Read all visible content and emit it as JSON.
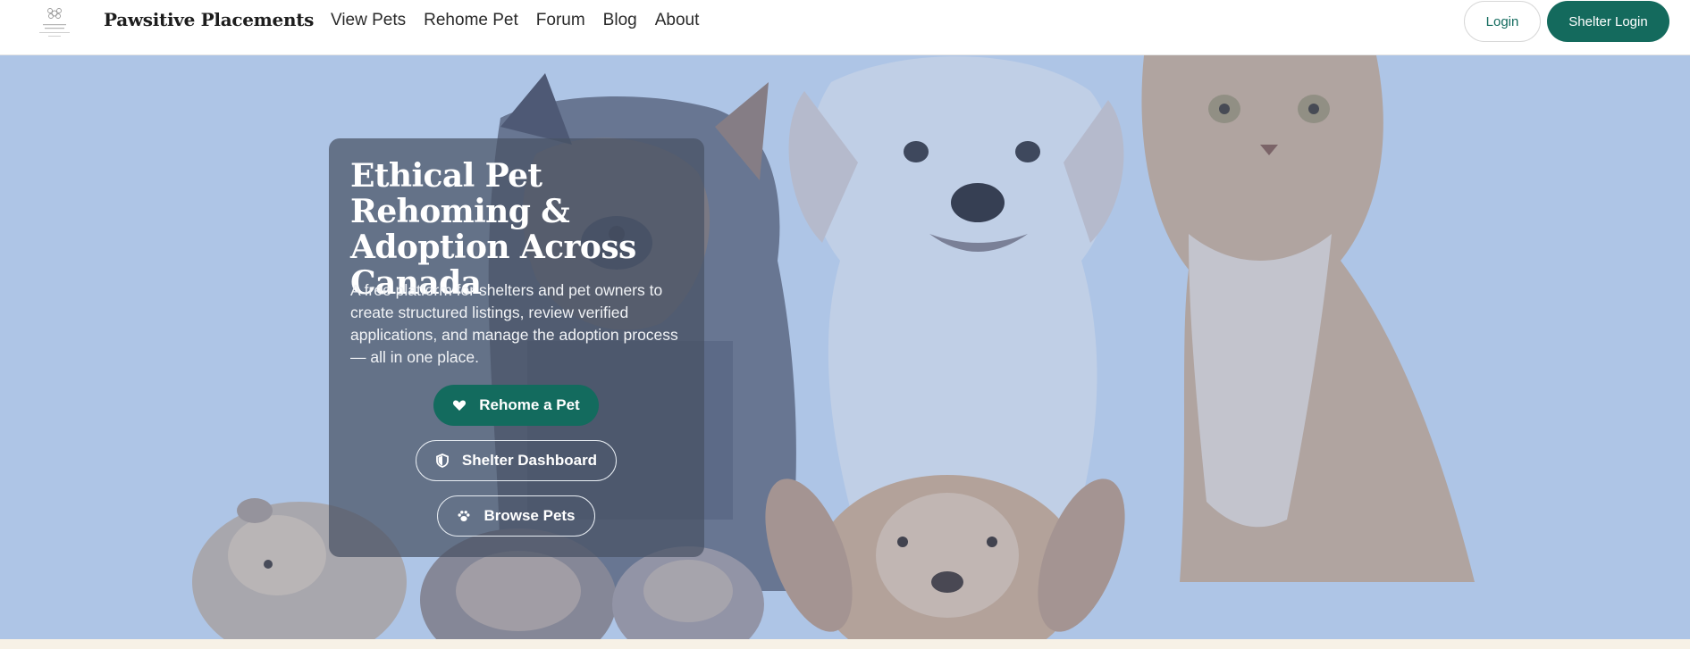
{
  "nav": {
    "brand": "Pawsitive Placements",
    "links": [
      "View Pets",
      "Rehome Pet",
      "Forum",
      "Blog",
      "About"
    ],
    "login_label": "Login",
    "shelter_login_label": "Shelter Login"
  },
  "hero": {
    "title": "Ethical Pet Rehoming & Adoption Across Canada",
    "description": "A free platform for shelters and pet owners to create structured listings, review verified applications, and manage the adoption process — all in one place.",
    "buttons": {
      "rehome": "Rehome a Pet",
      "shelter_dashboard": "Shelter Dashboard",
      "browse": "Browse Pets"
    }
  },
  "icons": {
    "rehome": "heart-icon",
    "shelter_dashboard": "shield-icon",
    "browse": "paw-icon"
  },
  "colors": {
    "accent": "#146a5d",
    "hero_tint": "#afc6e6"
  }
}
